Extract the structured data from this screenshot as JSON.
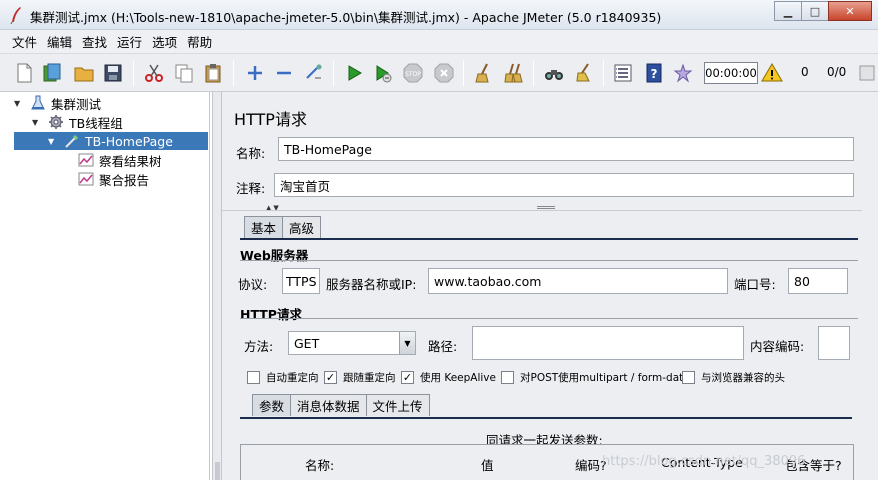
{
  "window": {
    "title": "集群测试.jmx (H:\\Tools-new-1810\\apache-jmeter-5.0\\bin\\集群测试.jmx) - Apache JMeter (5.0 r1840935)",
    "minimize": "▁",
    "maximize": "□",
    "close": "✕"
  },
  "menu": [
    "文件",
    "编辑",
    "查找",
    "运行",
    "选项",
    "帮助"
  ],
  "toolbar": {
    "timer": "00:00:00",
    "warnings": "0",
    "threads": "0/0"
  },
  "tree": {
    "items": [
      {
        "label": "集群测试"
      },
      {
        "label": "TB线程组"
      },
      {
        "label": "TB-HomePage"
      },
      {
        "label": "察看结果树"
      },
      {
        "label": "聚合报告"
      }
    ]
  },
  "panel": {
    "title": "HTTP请求",
    "name_label": "名称:",
    "name_value": "TB-HomePage",
    "comment_label": "注释:",
    "comment_value": "淘宝首页",
    "tabs": [
      "基本",
      "高级"
    ],
    "web_server": {
      "section": "Web服务器",
      "protocol_label": "协议:",
      "protocol_value": "TTPS",
      "server_label": "服务器名称或IP:",
      "server_value": "www.taobao.com",
      "port_label": "端口号:",
      "port_value": "80"
    },
    "http_request": {
      "section": "HTTP请求",
      "method_label": "方法:",
      "method_value": "GET",
      "path_label": "路径:",
      "path_value": "",
      "encoding_label": "内容编码:",
      "encoding_value": ""
    },
    "checkboxes": [
      {
        "label": "自动重定向",
        "checked": false
      },
      {
        "label": "跟随重定向",
        "checked": true
      },
      {
        "label": "使用 KeepAlive",
        "checked": true
      },
      {
        "label": "对POST使用multipart / form-data",
        "checked": false
      },
      {
        "label": "与浏览器兼容的头",
        "checked": false
      }
    ],
    "sub_tabs": [
      "参数",
      "消息体数据",
      "文件上传"
    ],
    "params_caption": "同请求一起发送参数:",
    "columns": [
      "名称:",
      "值",
      "编码?",
      "Content-Type",
      "包含等于?"
    ],
    "watermark": "https://blog.csdn.net/qq_38096"
  }
}
